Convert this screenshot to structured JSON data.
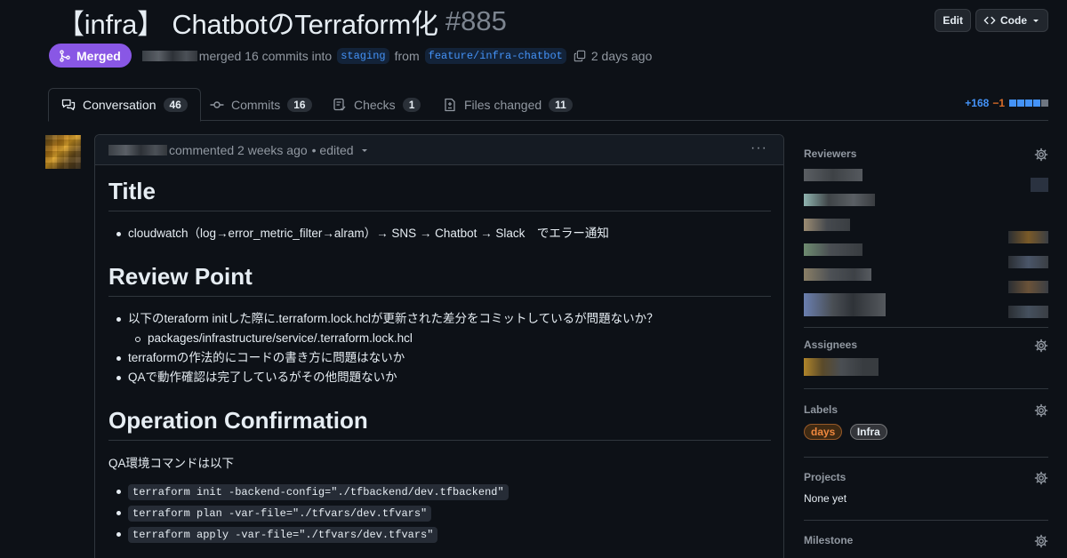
{
  "header": {
    "title": "【infra】 ChatbotのTerraform化",
    "number": "#885",
    "edit_label": "Edit",
    "code_label": "Code"
  },
  "meta": {
    "status": "Merged",
    "merged_text": "merged 16 commits into",
    "base_branch": "staging",
    "from_text": "from",
    "head_branch": "feature/infra-chatbot",
    "time": "2 days ago"
  },
  "tabs": [
    {
      "label": "Conversation",
      "count": "46",
      "icon": "comment-discussion-icon"
    },
    {
      "label": "Commits",
      "count": "16",
      "icon": "git-commit-icon"
    },
    {
      "label": "Checks",
      "count": "1",
      "icon": "checklist-icon"
    },
    {
      "label": "Files changed",
      "count": "11",
      "icon": "file-diff-icon"
    }
  ],
  "diffstat": {
    "additions": "+168",
    "deletions": "−1"
  },
  "comment": {
    "header_text": "commented 2 weeks ago",
    "edited": "• edited",
    "h_title": "Title",
    "title_item": "cloudwatch（log→error_metric_filter→alram）→ SNS → Chatbot → Slack　でエラー通知",
    "h_review": "Review Point",
    "review_items": [
      "以下のteraform initした際に.terraform.lock.hclが更新された差分をコミットしているが問題ないか？",
      "packages/infrastructure/service/.terraform.lock.hcl",
      "terraformの作法的にコードの書き方に問題はないか",
      "QAで動作確認は完了しているがその他問題ないか"
    ],
    "h_operation": "Operation Confirmation",
    "qa_text": "QA環境コマンドは以下",
    "commands": [
      "terraform init -backend-config=\"./tfbackend/dev.tfbackend\"",
      "terraform plan -var-file=\"./tfvars/dev.tfvars\"",
      "terraform apply -var-file=\"./tfvars/dev.tfvars\""
    ]
  },
  "sidebar": {
    "reviewers": "Reviewers",
    "assignees": "Assignees",
    "labels": "Labels",
    "label_items": [
      {
        "name": "days",
        "color": "#d97706"
      },
      {
        "name": "Infra",
        "color": "#8b8b8b"
      }
    ],
    "projects": "Projects",
    "projects_value": "None yet",
    "milestone": "Milestone"
  },
  "colors": {
    "merged": "#8957e5",
    "link": "#4493f8",
    "deletion": "#db6d28"
  }
}
